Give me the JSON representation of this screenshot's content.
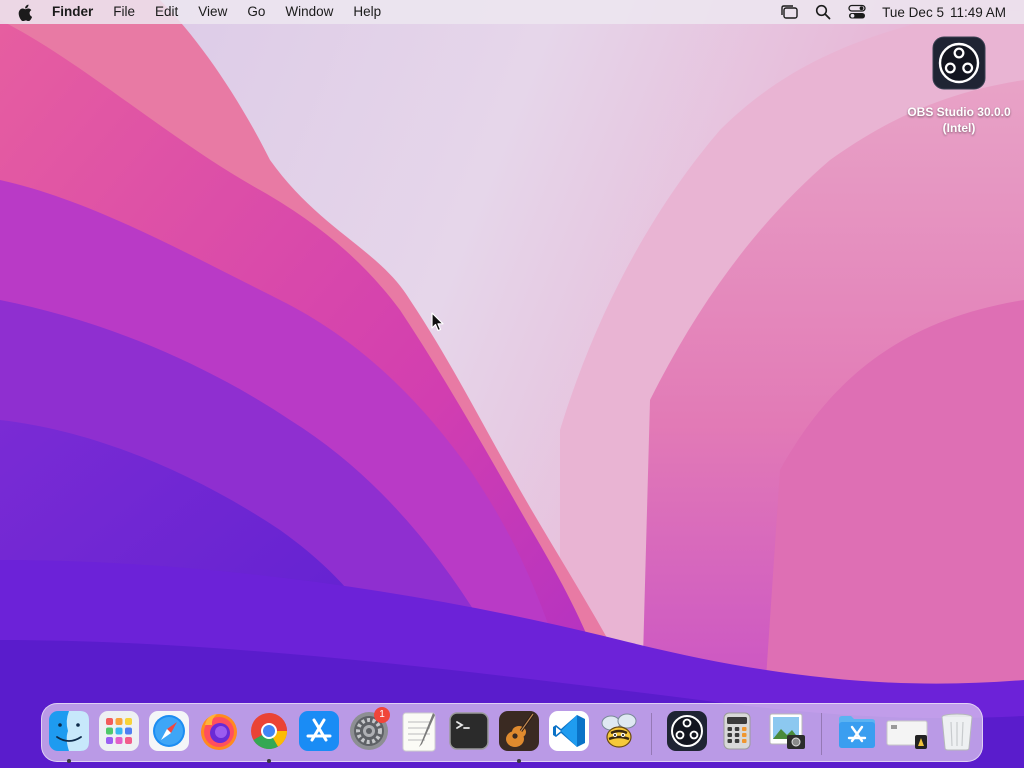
{
  "menubar": {
    "apple_icon": "apple-icon",
    "app_name": "Finder",
    "menus": [
      "File",
      "Edit",
      "View",
      "Go",
      "Window",
      "Help"
    ],
    "status_icons": [
      "stage-manager-icon",
      "search-icon",
      "control-center-icon"
    ],
    "clock": {
      "date": "Tue Dec 5",
      "time": "11:49 AM"
    }
  },
  "desktop_icons": [
    {
      "label": "OBS Studio 30.0.0\n(Intel)",
      "icon": "obs-icon"
    }
  ],
  "dock": {
    "apps": [
      {
        "icon": "finder-icon",
        "running": true
      },
      {
        "icon": "launchpad-icon",
        "running": false
      },
      {
        "icon": "safari-icon",
        "running": false
      },
      {
        "icon": "firefox-icon",
        "running": false
      },
      {
        "icon": "chrome-icon",
        "running": true
      },
      {
        "icon": "app-store-icon",
        "running": false
      },
      {
        "icon": "system-settings-icon",
        "running": false,
        "badge": "1"
      },
      {
        "icon": "textedit-icon",
        "running": false
      },
      {
        "icon": "terminal-icon",
        "running": false
      },
      {
        "icon": "garageband-icon",
        "running": true
      },
      {
        "icon": "vscode-icon",
        "running": false
      },
      {
        "icon": "bee-app-icon",
        "running": false
      }
    ],
    "recent_apps": [
      {
        "icon": "obs-icon",
        "running": false
      },
      {
        "icon": "calculator-icon",
        "running": false
      },
      {
        "icon": "preview-icon",
        "running": false
      }
    ],
    "other_items": [
      {
        "icon": "downloads-folder-icon"
      },
      {
        "icon": "file-stack-icon"
      },
      {
        "icon": "trash-icon"
      }
    ]
  },
  "colors": {
    "accent_pink": "#e0309a",
    "accent_purple": "#6a1fd6",
    "badge_red": "#f0453a"
  }
}
